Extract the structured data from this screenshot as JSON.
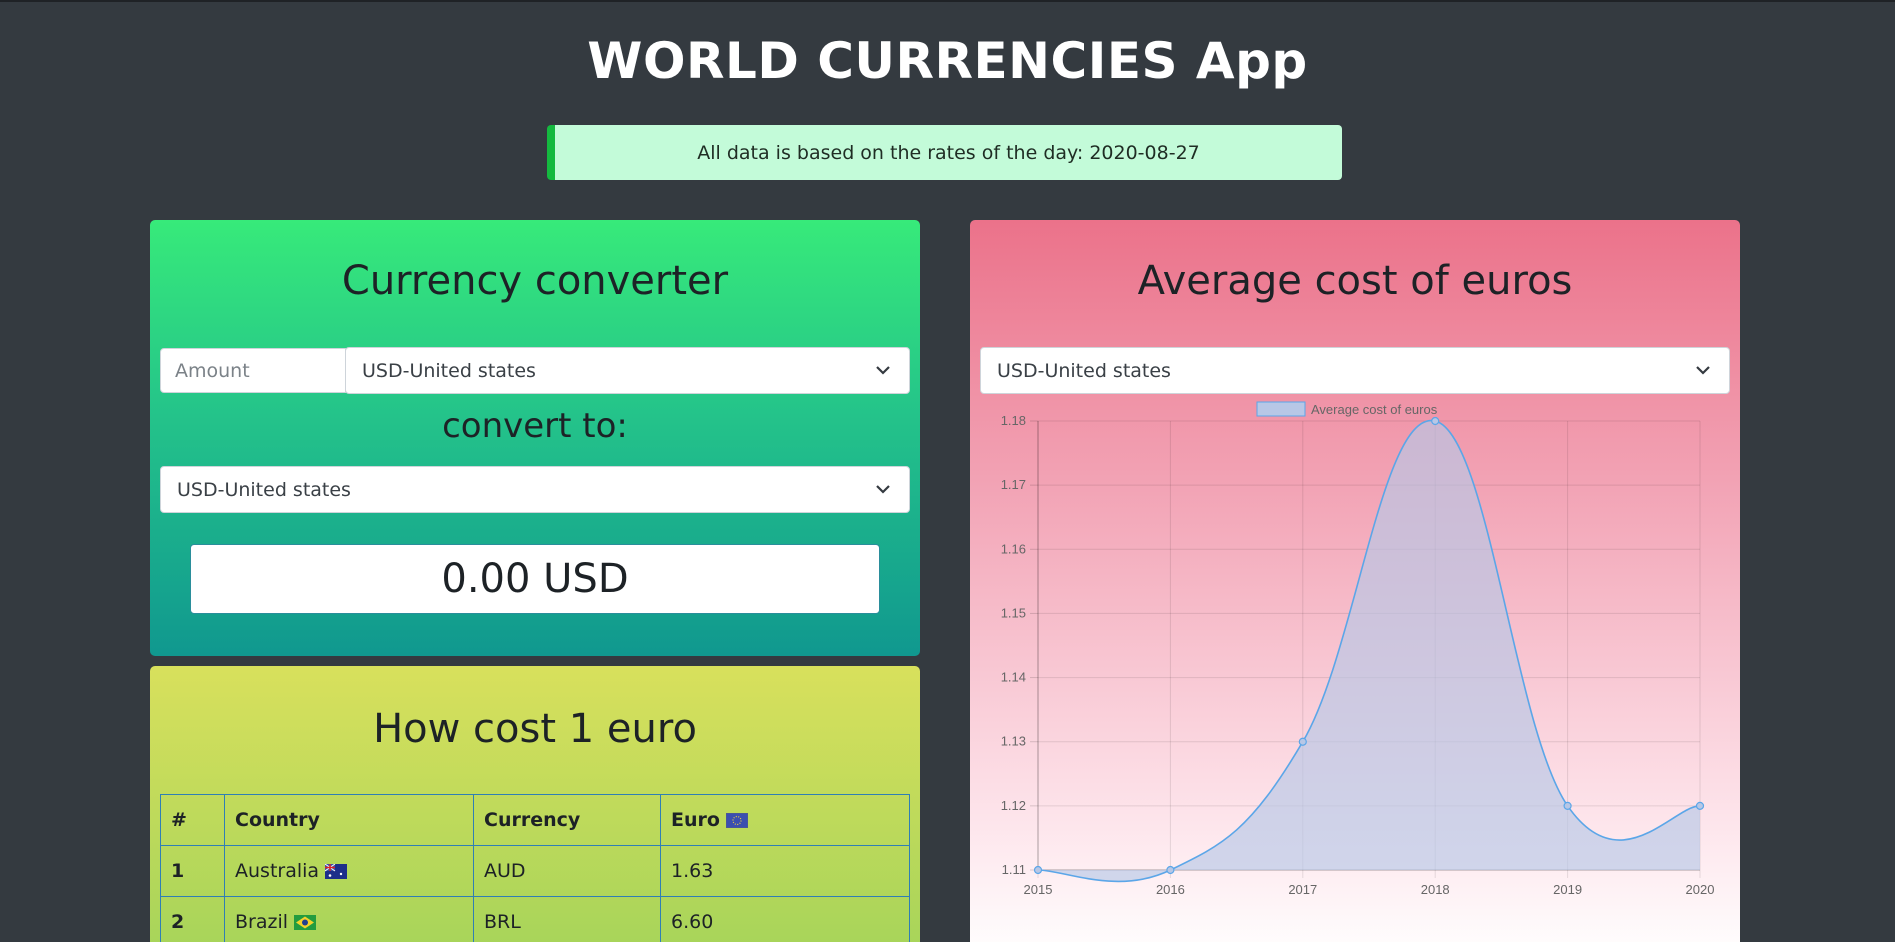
{
  "app": {
    "title": "WORLD CURRENCIES App",
    "banner": "All data is based on the rates of the day: 2020-08-27"
  },
  "converter": {
    "heading": "Currency converter",
    "amount_placeholder": "Amount",
    "from_currency": "USD-United states",
    "convert_to_label": "convert to:",
    "to_currency": "USD-United states",
    "result": "0.00 USD"
  },
  "table": {
    "heading": "How cost 1 euro",
    "columns": [
      "#",
      "Country",
      "Currency",
      "Euro"
    ],
    "rows": [
      {
        "num": "1",
        "country": "Australia",
        "flag": "australia-flag-icon",
        "currency": "AUD",
        "euro": "1.63"
      },
      {
        "num": "2",
        "country": "Brazil",
        "flag": "brazil-flag-icon",
        "currency": "BRL",
        "euro": "6.60"
      }
    ]
  },
  "chart_panel": {
    "heading": "Average cost of euros",
    "currency": "USD-United states"
  },
  "chart_data": {
    "type": "line",
    "legend": "Average cost of euros",
    "legend_position": "top",
    "x": [
      "2015",
      "2016",
      "2017",
      "2018",
      "2019",
      "2020"
    ],
    "series": [
      {
        "name": "Average cost of euros",
        "values": [
          1.11,
          1.11,
          1.13,
          1.18,
          1.12,
          1.12
        ]
      }
    ],
    "ylim": [
      1.11,
      1.18
    ],
    "yticks": [
      "1.18",
      "1.17",
      "1.16",
      "1.15",
      "1.14",
      "1.13",
      "1.12",
      "1.11"
    ],
    "grid": true,
    "fill": true,
    "line_color": "#5ba6e8",
    "fill_color": "#b7c7e6"
  },
  "colors": {
    "background": "#343a40",
    "banner_bg": "#c3fbd9",
    "banner_accent": "#14b93f"
  }
}
